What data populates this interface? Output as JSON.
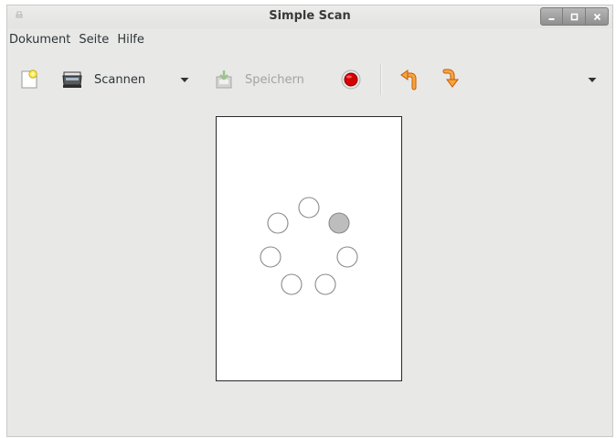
{
  "window": {
    "title": "Simple Scan",
    "controls": [
      "minimize",
      "maximize",
      "close"
    ]
  },
  "menubar": {
    "items": [
      "Dokument",
      "Seite",
      "Hilfe"
    ]
  },
  "toolbar": {
    "new_icon": "new-document-icon",
    "scan_label": "Scannen",
    "save_label": "Speichern",
    "save_enabled": false,
    "stop_icon": "stop-icon",
    "rotate_left_icon": "rotate-left-icon",
    "rotate_right_icon": "rotate-right-icon"
  },
  "document": {
    "status": "scanning",
    "spinner_dots": 7,
    "active_dot": 3
  }
}
